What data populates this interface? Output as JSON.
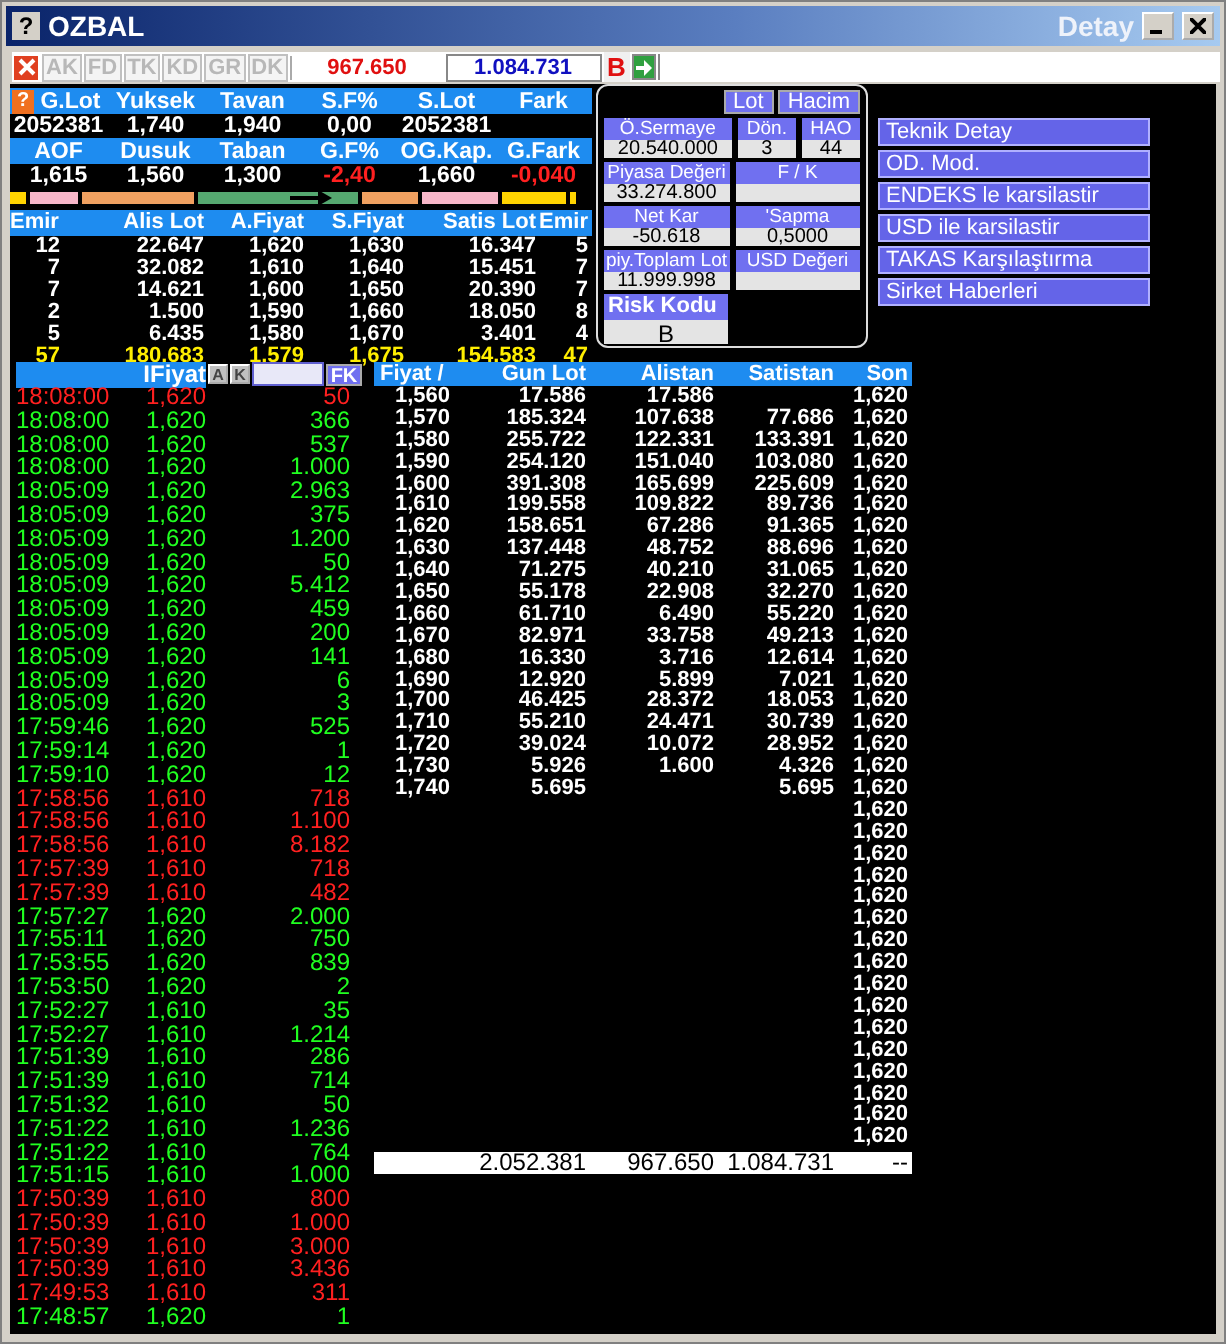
{
  "window": {
    "help": "?",
    "title": "OZBAL",
    "subtitle": "Detay"
  },
  "summary_help": "?",
  "toolbar": {
    "buttons": [
      {
        "label": "AK",
        "disabled": true
      },
      {
        "label": "FD",
        "disabled": true
      },
      {
        "label": "TK",
        "disabled": true
      },
      {
        "label": "KD",
        "disabled": true
      },
      {
        "label": "GR",
        "disabled": true
      },
      {
        "label": "DK",
        "disabled": true
      }
    ],
    "sell_total": "967.650",
    "buy_total": "1.084.731",
    "mode": "B"
  },
  "summary": [
    {
      "headers": [
        "G.Lot",
        "Yuksek",
        "Tavan",
        "S.F%",
        "S.Lot",
        "Fark"
      ],
      "values": [
        {
          "text": "2052381",
          "down": false
        },
        {
          "text": "1,740",
          "down": false
        },
        {
          "text": "1,940",
          "down": false
        },
        {
          "text": "0,00",
          "down": false
        },
        {
          "text": "2052381",
          "down": false
        }
      ]
    },
    {
      "headers": [
        "AOF",
        "Dusuk",
        "Taban",
        "G.F%",
        "OG.Kap.",
        "G.Fark"
      ],
      "values": [
        {
          "text": "1,615",
          "down": false
        },
        {
          "text": "1,560",
          "down": false
        },
        {
          "text": "1,300",
          "down": false
        },
        {
          "text": "-2,40",
          "down": true
        },
        {
          "text": "1,660",
          "down": false
        },
        {
          "text": "-0,040",
          "down": true
        }
      ]
    }
  ],
  "order_book": {
    "columns": [
      "Emir",
      "Alis Lot",
      "A.Fiyat",
      "S.Fiyat",
      "Satis Lot",
      "Emir"
    ],
    "rows": [
      [
        "12",
        "22.647",
        "1,620",
        "1,630",
        "16.347",
        "5"
      ],
      [
        "7",
        "32.082",
        "1,610",
        "1,640",
        "15.451",
        "7"
      ],
      [
        "7",
        "14.621",
        "1,600",
        "1,650",
        "20.390",
        "7"
      ],
      [
        "2",
        "1.500",
        "1,590",
        "1,660",
        "18.050",
        "8"
      ],
      [
        "5",
        "6.435",
        "1,580",
        "1,670",
        "3.401",
        "4"
      ]
    ],
    "total": [
      "57",
      "180.683",
      "1,579",
      "1,675",
      "154.583",
      "47"
    ]
  },
  "detay": {
    "tabs": [
      "Lot",
      "Hacim"
    ],
    "rows": [
      [
        {
          "label": "Ö.Sermaye",
          "value": "20.540.000"
        },
        {
          "label": "Dön.",
          "value": "3"
        },
        {
          "label": "HAO",
          "value": "44"
        }
      ],
      [
        {
          "label": "Piyasa Değeri",
          "value": "33.274.800"
        },
        {
          "label": "F / K"
        }
      ],
      [
        {
          "label": "Net Kar",
          "value": "-50.618"
        },
        {
          "label": "'Sapma",
          "value": "0,5000"
        }
      ],
      [
        {
          "label": "piy.Toplam Lot",
          "value": "11.999.998"
        },
        {
          "label": "USD Değeri"
        }
      ]
    ],
    "risk": {
      "label": "Risk Kodu",
      "value": "B"
    }
  },
  "links": [
    "Teknik Detay",
    "OD. Mod.",
    "ENDEKS le karsilastir",
    "USD ile karsilastir",
    "TAKAS Karşılaştırma",
    "Sirket Haberleri"
  ],
  "trades": {
    "header": "IFiyat",
    "buttons": [
      "A",
      "K"
    ],
    "fk": "FK",
    "rows": [
      {
        "time": "18:08:00",
        "price": "1,620",
        "lot": "50",
        "sell": true
      },
      {
        "time": "18:08:00",
        "price": "1,620",
        "lot": "366",
        "sell": false
      },
      {
        "time": "18:08:00",
        "price": "1,620",
        "lot": "537",
        "sell": false
      },
      {
        "time": "18:08:00",
        "price": "1,620",
        "lot": "1.000",
        "sell": false
      },
      {
        "time": "18:05:09",
        "price": "1,620",
        "lot": "2.963",
        "sell": false
      },
      {
        "time": "18:05:09",
        "price": "1,620",
        "lot": "375",
        "sell": false
      },
      {
        "time": "18:05:09",
        "price": "1,620",
        "lot": "1.200",
        "sell": false
      },
      {
        "time": "18:05:09",
        "price": "1,620",
        "lot": "50",
        "sell": false
      },
      {
        "time": "18:05:09",
        "price": "1,620",
        "lot": "5.412",
        "sell": false
      },
      {
        "time": "18:05:09",
        "price": "1,620",
        "lot": "459",
        "sell": false
      },
      {
        "time": "18:05:09",
        "price": "1,620",
        "lot": "200",
        "sell": false
      },
      {
        "time": "18:05:09",
        "price": "1,620",
        "lot": "141",
        "sell": false
      },
      {
        "time": "18:05:09",
        "price": "1,620",
        "lot": "6",
        "sell": false
      },
      {
        "time": "18:05:09",
        "price": "1,620",
        "lot": "3",
        "sell": false
      },
      {
        "time": "17:59:46",
        "price": "1,620",
        "lot": "525",
        "sell": false
      },
      {
        "time": "17:59:14",
        "price": "1,620",
        "lot": "1",
        "sell": false
      },
      {
        "time": "17:59:10",
        "price": "1,620",
        "lot": "12",
        "sell": false
      },
      {
        "time": "17:58:56",
        "price": "1,610",
        "lot": "718",
        "sell": true
      },
      {
        "time": "17:58:56",
        "price": "1,610",
        "lot": "1.100",
        "sell": true
      },
      {
        "time": "17:58:56",
        "price": "1,610",
        "lot": "8.182",
        "sell": true
      },
      {
        "time": "17:57:39",
        "price": "1,610",
        "lot": "718",
        "sell": true
      },
      {
        "time": "17:57:39",
        "price": "1,610",
        "lot": "482",
        "sell": true
      },
      {
        "time": "17:57:27",
        "price": "1,620",
        "lot": "2.000",
        "sell": false
      },
      {
        "time": "17:55:11",
        "price": "1,620",
        "lot": "750",
        "sell": false
      },
      {
        "time": "17:53:55",
        "price": "1,620",
        "lot": "839",
        "sell": false
      },
      {
        "time": "17:53:50",
        "price": "1,620",
        "lot": "2",
        "sell": false
      },
      {
        "time": "17:52:27",
        "price": "1,610",
        "lot": "35",
        "sell": false
      },
      {
        "time": "17:52:27",
        "price": "1,610",
        "lot": "1.214",
        "sell": false
      },
      {
        "time": "17:51:39",
        "price": "1,610",
        "lot": "286",
        "sell": false
      },
      {
        "time": "17:51:39",
        "price": "1,610",
        "lot": "714",
        "sell": false
      },
      {
        "time": "17:51:32",
        "price": "1,610",
        "lot": "50",
        "sell": false
      },
      {
        "time": "17:51:22",
        "price": "1,610",
        "lot": "1.236",
        "sell": false
      },
      {
        "time": "17:51:22",
        "price": "1,610",
        "lot": "764",
        "sell": false
      },
      {
        "time": "17:51:15",
        "price": "1,610",
        "lot": "1.000",
        "sell": false
      },
      {
        "time": "17:50:39",
        "price": "1,610",
        "lot": "800",
        "sell": true
      },
      {
        "time": "17:50:39",
        "price": "1,610",
        "lot": "1.000",
        "sell": true
      },
      {
        "time": "17:50:39",
        "price": "1,610",
        "lot": "3.000",
        "sell": true
      },
      {
        "time": "17:50:39",
        "price": "1,610",
        "lot": "3.436",
        "sell": true
      },
      {
        "time": "17:49:53",
        "price": "1,610",
        "lot": "311",
        "sell": true
      },
      {
        "time": "17:48:57",
        "price": "1,620",
        "lot": "1",
        "sell": false
      }
    ]
  },
  "price_table": {
    "columns": [
      "Fiyat /",
      "Gun Lot",
      "Alistan",
      "Satistan",
      "Son"
    ],
    "rows": [
      {
        "fiyat": "1,560",
        "gun_lot": "17.586",
        "alistan": "17.586",
        "son": "1,620"
      },
      {
        "fiyat": "1,570",
        "gun_lot": "185.324",
        "alistan": "107.638",
        "satistan": "77.686",
        "son": "1,620"
      },
      {
        "fiyat": "1,580",
        "gun_lot": "255.722",
        "alistan": "122.331",
        "satistan": "133.391",
        "son": "1,620"
      },
      {
        "fiyat": "1,590",
        "gun_lot": "254.120",
        "alistan": "151.040",
        "satistan": "103.080",
        "son": "1,620"
      },
      {
        "fiyat": "1,600",
        "gun_lot": "391.308",
        "alistan": "165.699",
        "satistan": "225.609",
        "son": "1,620"
      },
      {
        "fiyat": "1,610",
        "gun_lot": "199.558",
        "alistan": "109.822",
        "satistan": "89.736",
        "son": "1,620"
      },
      {
        "fiyat": "1,620",
        "gun_lot": "158.651",
        "alistan": "67.286",
        "satistan": "91.365",
        "son": "1,620"
      },
      {
        "fiyat": "1,630",
        "gun_lot": "137.448",
        "alistan": "48.752",
        "satistan": "88.696",
        "son": "1,620"
      },
      {
        "fiyat": "1,640",
        "gun_lot": "71.275",
        "alistan": "40.210",
        "satistan": "31.065",
        "son": "1,620"
      },
      {
        "fiyat": "1,650",
        "gun_lot": "55.178",
        "alistan": "22.908",
        "satistan": "32.270",
        "son": "1,620"
      },
      {
        "fiyat": "1,660",
        "gun_lot": "61.710",
        "alistan": "6.490",
        "satistan": "55.220",
        "son": "1,620"
      },
      {
        "fiyat": "1,670",
        "gun_lot": "82.971",
        "alistan": "33.758",
        "satistan": "49.213",
        "son": "1,620"
      },
      {
        "fiyat": "1,680",
        "gun_lot": "16.330",
        "alistan": "3.716",
        "satistan": "12.614",
        "son": "1,620"
      },
      {
        "fiyat": "1,690",
        "gun_lot": "12.920",
        "alistan": "5.899",
        "satistan": "7.021",
        "son": "1,620"
      },
      {
        "fiyat": "1,700",
        "gun_lot": "46.425",
        "alistan": "28.372",
        "satistan": "18.053",
        "son": "1,620"
      },
      {
        "fiyat": "1,710",
        "gun_lot": "55.210",
        "alistan": "24.471",
        "satistan": "30.739",
        "son": "1,620"
      },
      {
        "fiyat": "1,720",
        "gun_lot": "39.024",
        "alistan": "10.072",
        "satistan": "28.952",
        "son": "1,620"
      },
      {
        "fiyat": "1,730",
        "gun_lot": "5.926",
        "alistan": "1.600",
        "satistan": "4.326",
        "son": "1,620"
      },
      {
        "fiyat": "1,740",
        "gun_lot": "5.695",
        "satistan": "5.695",
        "son": "1,620"
      },
      {
        "son": "1,620"
      },
      {
        "son": "1,620"
      },
      {
        "son": "1,620"
      },
      {
        "son": "1,620"
      },
      {
        "son": "1,620"
      },
      {
        "son": "1,620"
      },
      {
        "son": "1,620"
      },
      {
        "son": "1,620"
      },
      {
        "son": "1,620"
      },
      {
        "son": "1,620"
      },
      {
        "son": "1,620"
      },
      {
        "son": "1,620"
      },
      {
        "son": "1,620"
      },
      {
        "son": "1,620"
      },
      {
        "son": "1,620"
      },
      {
        "son": "1,620"
      }
    ],
    "total": {
      "gun_lot": "2.052.381",
      "alistan": "967.650",
      "satistan": "1.084.731",
      "son": "--"
    }
  }
}
